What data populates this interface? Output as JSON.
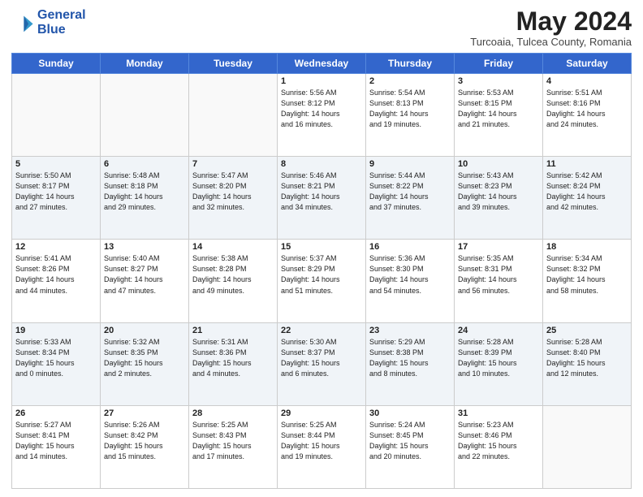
{
  "header": {
    "logo_line1": "General",
    "logo_line2": "Blue",
    "month": "May 2024",
    "location": "Turcoaia, Tulcea County, Romania"
  },
  "weekdays": [
    "Sunday",
    "Monday",
    "Tuesday",
    "Wednesday",
    "Thursday",
    "Friday",
    "Saturday"
  ],
  "weeks": [
    [
      {
        "day": "",
        "info": ""
      },
      {
        "day": "",
        "info": ""
      },
      {
        "day": "",
        "info": ""
      },
      {
        "day": "1",
        "info": "Sunrise: 5:56 AM\nSunset: 8:12 PM\nDaylight: 14 hours\nand 16 minutes."
      },
      {
        "day": "2",
        "info": "Sunrise: 5:54 AM\nSunset: 8:13 PM\nDaylight: 14 hours\nand 19 minutes."
      },
      {
        "day": "3",
        "info": "Sunrise: 5:53 AM\nSunset: 8:15 PM\nDaylight: 14 hours\nand 21 minutes."
      },
      {
        "day": "4",
        "info": "Sunrise: 5:51 AM\nSunset: 8:16 PM\nDaylight: 14 hours\nand 24 minutes."
      }
    ],
    [
      {
        "day": "5",
        "info": "Sunrise: 5:50 AM\nSunset: 8:17 PM\nDaylight: 14 hours\nand 27 minutes."
      },
      {
        "day": "6",
        "info": "Sunrise: 5:48 AM\nSunset: 8:18 PM\nDaylight: 14 hours\nand 29 minutes."
      },
      {
        "day": "7",
        "info": "Sunrise: 5:47 AM\nSunset: 8:20 PM\nDaylight: 14 hours\nand 32 minutes."
      },
      {
        "day": "8",
        "info": "Sunrise: 5:46 AM\nSunset: 8:21 PM\nDaylight: 14 hours\nand 34 minutes."
      },
      {
        "day": "9",
        "info": "Sunrise: 5:44 AM\nSunset: 8:22 PM\nDaylight: 14 hours\nand 37 minutes."
      },
      {
        "day": "10",
        "info": "Sunrise: 5:43 AM\nSunset: 8:23 PM\nDaylight: 14 hours\nand 39 minutes."
      },
      {
        "day": "11",
        "info": "Sunrise: 5:42 AM\nSunset: 8:24 PM\nDaylight: 14 hours\nand 42 minutes."
      }
    ],
    [
      {
        "day": "12",
        "info": "Sunrise: 5:41 AM\nSunset: 8:26 PM\nDaylight: 14 hours\nand 44 minutes."
      },
      {
        "day": "13",
        "info": "Sunrise: 5:40 AM\nSunset: 8:27 PM\nDaylight: 14 hours\nand 47 minutes."
      },
      {
        "day": "14",
        "info": "Sunrise: 5:38 AM\nSunset: 8:28 PM\nDaylight: 14 hours\nand 49 minutes."
      },
      {
        "day": "15",
        "info": "Sunrise: 5:37 AM\nSunset: 8:29 PM\nDaylight: 14 hours\nand 51 minutes."
      },
      {
        "day": "16",
        "info": "Sunrise: 5:36 AM\nSunset: 8:30 PM\nDaylight: 14 hours\nand 54 minutes."
      },
      {
        "day": "17",
        "info": "Sunrise: 5:35 AM\nSunset: 8:31 PM\nDaylight: 14 hours\nand 56 minutes."
      },
      {
        "day": "18",
        "info": "Sunrise: 5:34 AM\nSunset: 8:32 PM\nDaylight: 14 hours\nand 58 minutes."
      }
    ],
    [
      {
        "day": "19",
        "info": "Sunrise: 5:33 AM\nSunset: 8:34 PM\nDaylight: 15 hours\nand 0 minutes."
      },
      {
        "day": "20",
        "info": "Sunrise: 5:32 AM\nSunset: 8:35 PM\nDaylight: 15 hours\nand 2 minutes."
      },
      {
        "day": "21",
        "info": "Sunrise: 5:31 AM\nSunset: 8:36 PM\nDaylight: 15 hours\nand 4 minutes."
      },
      {
        "day": "22",
        "info": "Sunrise: 5:30 AM\nSunset: 8:37 PM\nDaylight: 15 hours\nand 6 minutes."
      },
      {
        "day": "23",
        "info": "Sunrise: 5:29 AM\nSunset: 8:38 PM\nDaylight: 15 hours\nand 8 minutes."
      },
      {
        "day": "24",
        "info": "Sunrise: 5:28 AM\nSunset: 8:39 PM\nDaylight: 15 hours\nand 10 minutes."
      },
      {
        "day": "25",
        "info": "Sunrise: 5:28 AM\nSunset: 8:40 PM\nDaylight: 15 hours\nand 12 minutes."
      }
    ],
    [
      {
        "day": "26",
        "info": "Sunrise: 5:27 AM\nSunset: 8:41 PM\nDaylight: 15 hours\nand 14 minutes."
      },
      {
        "day": "27",
        "info": "Sunrise: 5:26 AM\nSunset: 8:42 PM\nDaylight: 15 hours\nand 15 minutes."
      },
      {
        "day": "28",
        "info": "Sunrise: 5:25 AM\nSunset: 8:43 PM\nDaylight: 15 hours\nand 17 minutes."
      },
      {
        "day": "29",
        "info": "Sunrise: 5:25 AM\nSunset: 8:44 PM\nDaylight: 15 hours\nand 19 minutes."
      },
      {
        "day": "30",
        "info": "Sunrise: 5:24 AM\nSunset: 8:45 PM\nDaylight: 15 hours\nand 20 minutes."
      },
      {
        "day": "31",
        "info": "Sunrise: 5:23 AM\nSunset: 8:46 PM\nDaylight: 15 hours\nand 22 minutes."
      },
      {
        "day": "",
        "info": ""
      }
    ]
  ]
}
